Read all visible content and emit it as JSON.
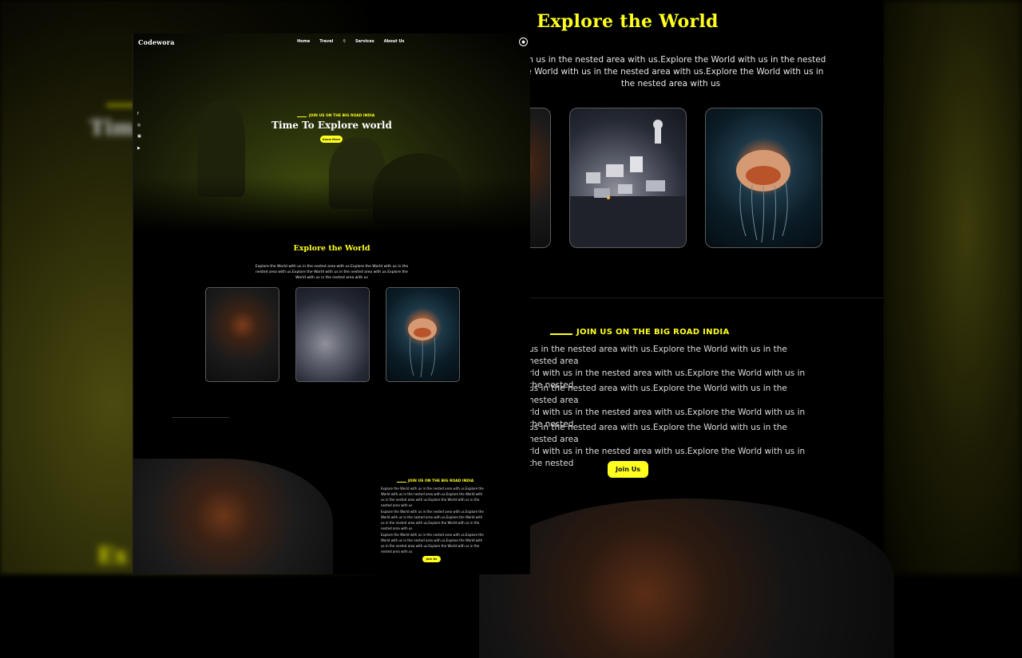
{
  "brand": "Codewora",
  "nav": {
    "items": [
      "Home",
      "Travel",
      "Services",
      "About Us"
    ]
  },
  "hero": {
    "tagline": "JOIN US ON THE BIG ROAD INDIA",
    "title": "Time To Explore world",
    "button": "Know More"
  },
  "explore": {
    "title": "Explore the World",
    "description": "Explore the World with us in the nested area with us.Explore the World with us in the nested area with us.Explore the World with us in the nested area with us.Explore the World with us in the nested area with us"
  },
  "join": {
    "tagline": "JOIN US ON THE BIG ROAD INDIA",
    "paragraph": "Explore the World with us in the nested area with us.Explore the World with us in the nested area with us.Explore the World with us in the nested area with us.Explore the World with us in the nested area with us",
    "button": "Join Us"
  },
  "zoom": {
    "title": "Explore the World",
    "desc_line1": "with us in the nested area with us.Explore the World with us in the nested",
    "desc_line2": "the World with us in the nested area with us.Explore the World with us in",
    "desc_line3": "the nested area with us",
    "join_tagline": "JOIN US ON THE BIG ROAD INDIA",
    "para_line_a": "us in the nested area with us.Explore the World with us in the nested area",
    "para_line_b": "rld with us in the nested area with us.Explore the World with us in the nested",
    "button": "Join Us"
  },
  "background": {
    "left_ghost_top": "Tim",
    "left_ghost_bottom": "Ex"
  },
  "icons": [
    "facebook-icon",
    "instagram-icon",
    "linkedin-icon",
    "youtube-icon",
    "user-icon",
    "search-icon"
  ],
  "colors": {
    "accent": "#ffff1f",
    "background": "#000000"
  }
}
